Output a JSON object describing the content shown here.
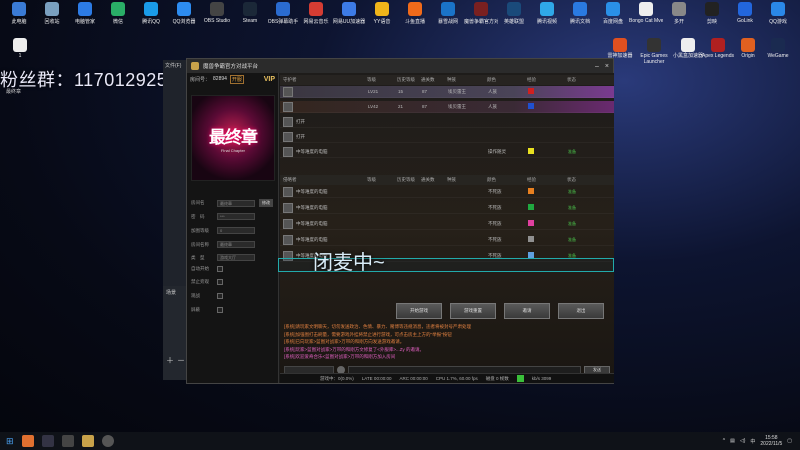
{
  "desktop": {
    "icons": [
      {
        "label": "此电脑",
        "color": "#3a7bd5"
      },
      {
        "label": "回收站",
        "color": "#7aa0c0"
      },
      {
        "label": "电脑管家",
        "color": "#2c7be5"
      },
      {
        "label": "微信",
        "color": "#2aae67"
      },
      {
        "label": "腾讯QQ",
        "color": "#1a9be8"
      },
      {
        "label": "QQ浏览器",
        "color": "#2d8cf0"
      },
      {
        "label": "OBS Studio",
        "color": "#444"
      },
      {
        "label": "Steam",
        "color": "#1b2838"
      },
      {
        "label": "OBS弹幕助手",
        "color": "#2a6bd0"
      },
      {
        "label": "网易云音乐",
        "color": "#d43c33"
      },
      {
        "label": "网易UU加速器",
        "color": "#3d7be6"
      },
      {
        "label": "YY语音",
        "color": "#f0b51a"
      },
      {
        "label": "斗鱼直播",
        "color": "#f06a1a"
      },
      {
        "label": "暴雪战网",
        "color": "#1a73c8"
      },
      {
        "label": "魔兽争霸官方对战平台",
        "color": "#7a2020"
      },
      {
        "label": "英雄联盟",
        "color": "#1a4a7a"
      },
      {
        "label": "腾讯视频",
        "color": "#2fa8e8"
      },
      {
        "label": "腾讯文档",
        "color": "#2a7ae2"
      },
      {
        "label": "百度网盘",
        "color": "#2a90e8"
      },
      {
        "label": "Bongo Cat Mver",
        "color": "#eee"
      },
      {
        "label": "多开",
        "color": "#888"
      },
      {
        "label": "剪映",
        "color": "#222"
      },
      {
        "label": "GoLink",
        "color": "#2266dd"
      },
      {
        "label": "QQ游戏",
        "color": "#2a88e8"
      }
    ],
    "second_row": [
      {
        "label": "1",
        "color": "#eee"
      },
      {
        "label": "雷神加速器",
        "color": "#e05020"
      },
      {
        "label": "Epic Games Launcher",
        "color": "#333"
      },
      {
        "label": "小黑盒加速器",
        "color": "#eee"
      },
      {
        "label": "Apex Legends",
        "color": "#b02020"
      },
      {
        "label": "Origin",
        "color": "#e06020"
      },
      {
        "label": "WeGame",
        "color": "#1a2a50"
      }
    ],
    "fans_text": "粉丝群：117012925",
    "side_label": "最终章"
  },
  "obs": {
    "label": "文件(F)",
    "scene": "场景"
  },
  "window": {
    "title": "魔兽争霸官方对战平台",
    "room_label": "房间号：",
    "room_no": "82894",
    "room_tag": "开服",
    "vip": "VIP",
    "cover_title": "最终章",
    "cover_sub": "Final Chapter",
    "fields": [
      {
        "label": "房间名",
        "value": "最终章",
        "btn": "修改"
      },
      {
        "label": "密　码",
        "value": "***",
        "btn": ""
      },
      {
        "label": "加图等级",
        "value": "0",
        "btn": ""
      },
      {
        "label": "房间名称",
        "value": "最终章",
        "btn": ""
      },
      {
        "label": "类　型",
        "value": "游戏大厅",
        "btn": ""
      },
      {
        "label": "自动开始",
        "value": "",
        "btn": ""
      },
      {
        "label": "禁止旁观",
        "value": "",
        "btn": ""
      },
      {
        "label": "观战",
        "value": "",
        "btn": ""
      },
      {
        "label": "屏蔽",
        "value": "",
        "btn": ""
      }
    ]
  },
  "table1": {
    "headers": [
      "守护者",
      "等级",
      "历史等级",
      "通关数",
      "种族",
      "颜色",
      "经验",
      "状态"
    ],
    "rows": [
      {
        "name": "",
        "level": "LV21",
        "hist": "15",
        "clear": "87",
        "area": "埃贝雷王",
        "race": "人族",
        "color": "#d02020",
        "exp": "",
        "status": ""
      },
      {
        "name": "",
        "level": "LV42",
        "hist": "21",
        "clear": "87",
        "area": "埃贝雷王",
        "race": "人族",
        "color": "#2050d0",
        "exp": "",
        "status": ""
      },
      {
        "name": "打开",
        "level": "",
        "hist": "",
        "clear": "",
        "area": "",
        "race": "",
        "color": "",
        "exp": "",
        "status": ""
      },
      {
        "name": "打开",
        "level": "",
        "hist": "",
        "clear": "",
        "area": "",
        "race": "",
        "color": "",
        "exp": "",
        "status": ""
      },
      {
        "name": "中等难度的电脑",
        "level": "",
        "hist": "",
        "clear": "",
        "area": "",
        "race": "操作随灵",
        "color": "#e8e020",
        "exp": "",
        "status": "准备"
      }
    ]
  },
  "table2": {
    "headers": [
      "侵略者",
      "等级",
      "历史等级",
      "通关数",
      "种族",
      "颜色",
      "经验",
      "状态"
    ],
    "rows": [
      {
        "name": "中等难度的电脑",
        "race": "不死族",
        "color": "#e88020",
        "status": "准备"
      },
      {
        "name": "中等难度的电脑",
        "race": "不死族",
        "color": "#20a840",
        "status": "准备"
      },
      {
        "name": "中等难度的电脑",
        "race": "不死族",
        "color": "#e040a0",
        "status": "准备"
      },
      {
        "name": "中等难度的电脑",
        "race": "不死族",
        "color": "#909090",
        "status": "准备"
      },
      {
        "name": "中等难度的电脑",
        "race": "不死族",
        "color": "#60a0e0",
        "status": "准备"
      }
    ]
  },
  "buttons": [
    "开始游戏",
    "游戏重置",
    "邀请",
    "退出"
  ],
  "chat": [
    {
      "text": "[系统]请玩家文明聊天，切勿发送政治、色情、暴力、赌博等违规消息，违者将被封号严肃处理",
      "color": "#e08040"
    },
    {
      "text": "[系统]加强图打击刷量，需要游戏外挂将禁止进行游戏，可点击房主上方的\"举报\"按钮",
      "color": "#e08040"
    },
    {
      "text": "[系统]已向玩家>蓝图对战家>万带的和刚方向发送游戏邀请。",
      "color": "#e08040"
    },
    {
      "text": "[系统]玩家>蓝图对战家>万带的和刚方文修复了<外服库>...Zy 的邀请。",
      "color": "#e060c0"
    },
    {
      "text": "[系统]欢迎爱奇合乐<蓝图对战家>万带的和刚方加入房间",
      "color": "#e060c0"
    }
  ],
  "send_label": "发送",
  "status_bar": {
    "fps": "游戏中：0(0.0%)",
    "latency": "LATE 00:00:00",
    "arc": "ARC 00:00:00",
    "cpu": "CPU 1.7%, 60.00 fps",
    "disk": "磁盘 0 帧数",
    "speed": "kb/s 3099"
  },
  "overlay": "闭麦中~",
  "taskbar": {
    "time": "15:58",
    "date": "2022/11/5",
    "lang": "中"
  }
}
